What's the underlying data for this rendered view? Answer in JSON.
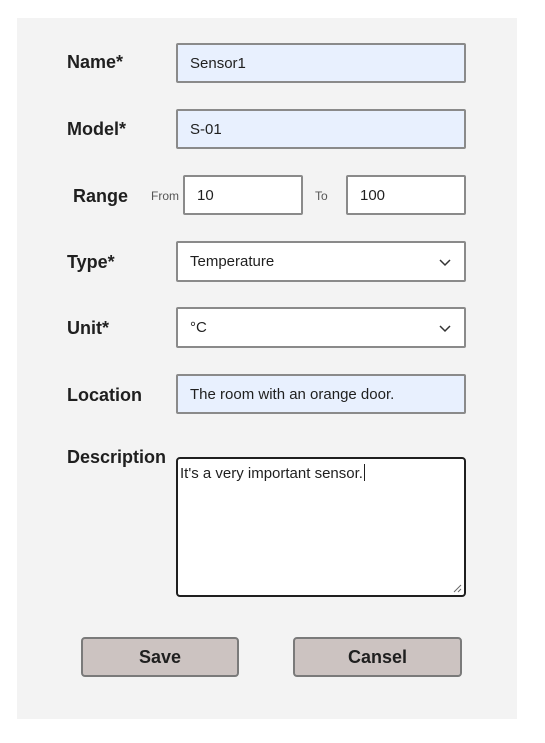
{
  "form": {
    "name": {
      "label": "Name*",
      "value": "Sensor1"
    },
    "model": {
      "label": "Model*",
      "value": "S-01"
    },
    "range": {
      "label": "Range",
      "from_label": "From",
      "from_value": "10",
      "to_label": "To",
      "to_value": "100"
    },
    "type": {
      "label": "Type*",
      "value": "Temperature"
    },
    "unit": {
      "label": "Unit*",
      "value": "°C"
    },
    "location": {
      "label": "Location",
      "value": "The room with an orange door."
    },
    "description": {
      "label": "Description",
      "value": "It's a very important sensor."
    }
  },
  "buttons": {
    "save": "Save",
    "cancel": "Cansel"
  },
  "colors": {
    "panel": "#f3f3f3",
    "field_filled": "#e8f0fe",
    "button": "#ccc3c1",
    "border": "#8a8a8a"
  },
  "icons": {
    "dropdown": "chevron-down-icon",
    "resize": "resize-grip-icon"
  }
}
